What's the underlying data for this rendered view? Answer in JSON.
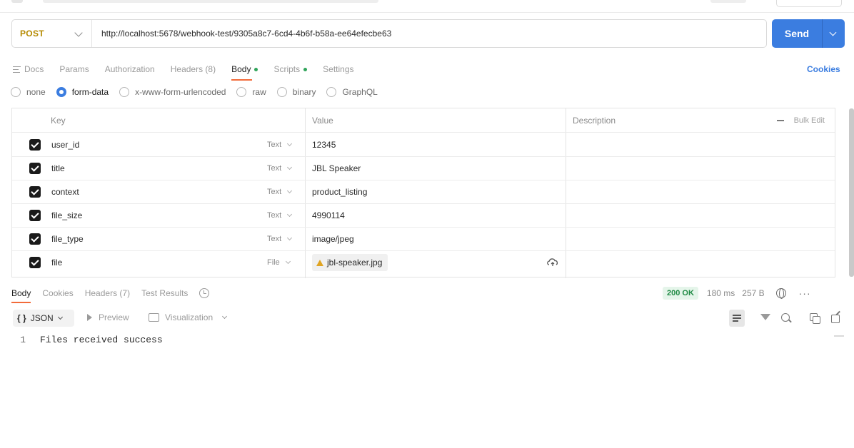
{
  "request": {
    "method": "POST",
    "url": "http://localhost:5678/webhook-test/9305a8c7-6cd4-4b6f-b58a-ee64efecbe63",
    "send_label": "Send"
  },
  "request_tabs": [
    {
      "label": "Docs",
      "active": false
    },
    {
      "label": "Params",
      "active": false
    },
    {
      "label": "Authorization",
      "active": false
    },
    {
      "label": "Headers (8)",
      "active": false
    },
    {
      "label": "Body",
      "active": true,
      "dot": true
    },
    {
      "label": "Scripts",
      "active": false,
      "dot": true
    },
    {
      "label": "Settings",
      "active": false
    }
  ],
  "cookies_label": "Cookies",
  "body_types": [
    {
      "label": "none",
      "checked": false
    },
    {
      "label": "form-data",
      "checked": true
    },
    {
      "label": "x-www-form-urlencoded",
      "checked": false
    },
    {
      "label": "raw",
      "checked": false
    },
    {
      "label": "binary",
      "checked": false
    },
    {
      "label": "GraphQL",
      "checked": false
    }
  ],
  "params_table": {
    "headers": {
      "key": "Key",
      "value": "Value",
      "description": "Description",
      "bulk_edit": "Bulk Edit"
    },
    "rows": [
      {
        "key": "user_id",
        "type": "Text",
        "value": "12345"
      },
      {
        "key": "title",
        "type": "Text",
        "value": "JBL Speaker"
      },
      {
        "key": "context",
        "type": "Text",
        "value": "product_listing"
      },
      {
        "key": "file_size",
        "type": "Text",
        "value": "4990114"
      },
      {
        "key": "file_type",
        "type": "Text",
        "value": "image/jpeg"
      },
      {
        "key": "file",
        "type": "File",
        "value": "jbl-speaker.jpg"
      }
    ]
  },
  "response_tabs": [
    {
      "label": "Body",
      "active": true
    },
    {
      "label": "Cookies",
      "active": false
    },
    {
      "label": "Headers (7)",
      "active": false
    },
    {
      "label": "Test Results",
      "active": false
    }
  ],
  "response_meta": {
    "status": "200 OK",
    "time": "180 ms",
    "size": "257 B"
  },
  "response_toolbar": {
    "format": "JSON",
    "preview": "Preview",
    "visualization": "Visualization"
  },
  "response_body": {
    "line_number": "1",
    "text": "Files received success"
  },
  "colors": {
    "accent": "#3b7de0",
    "active_tab_underline": "#f26b3a",
    "method": "#b58a00",
    "status_ok": "#1f8a44"
  }
}
